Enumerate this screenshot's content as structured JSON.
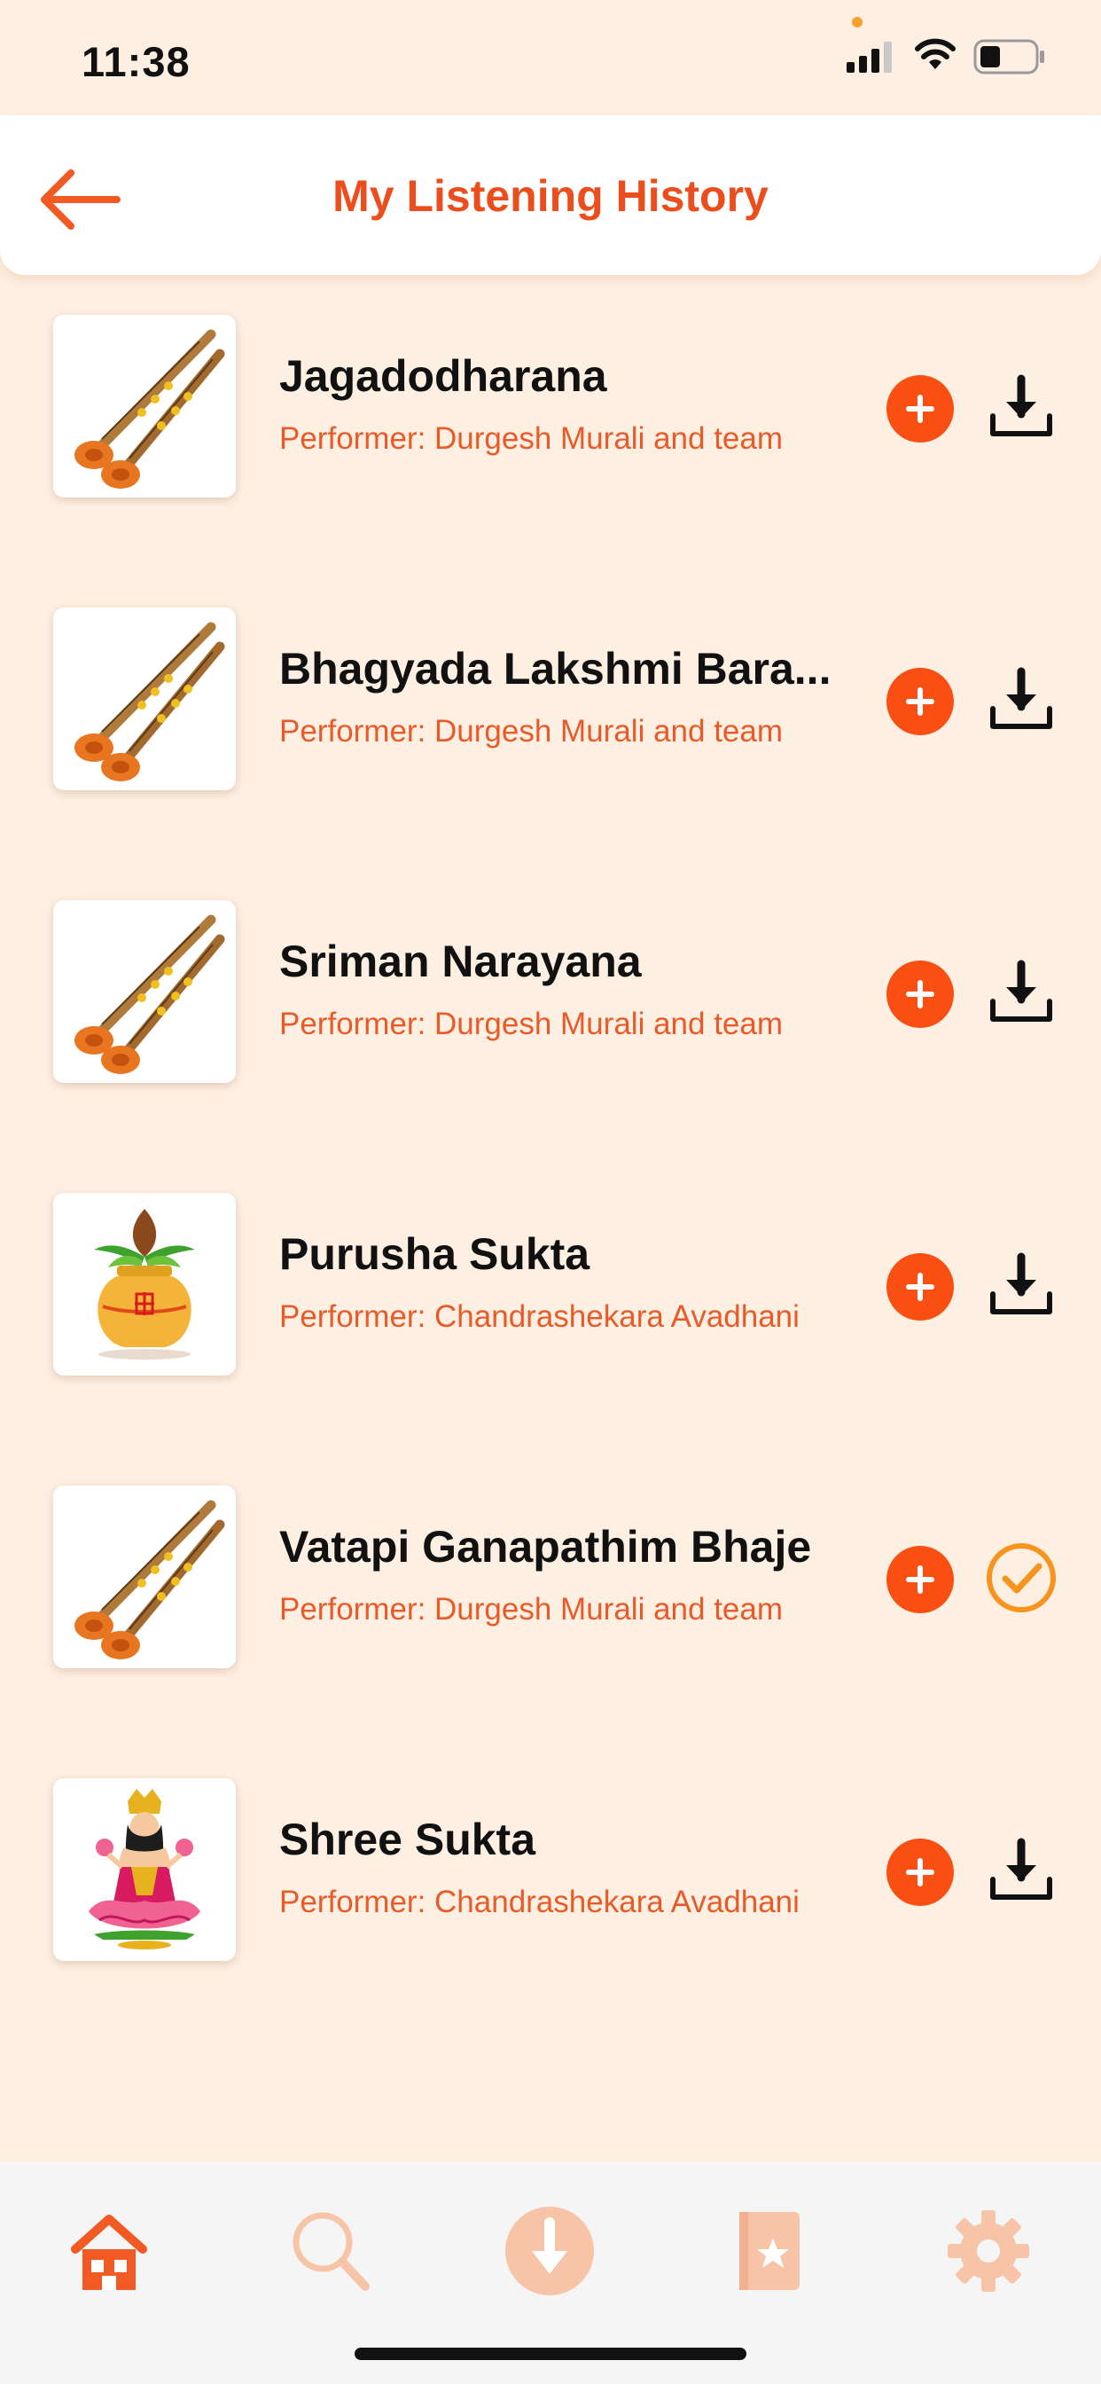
{
  "status_bar": {
    "time": "11:38"
  },
  "header": {
    "title": "My Listening History",
    "back_icon": "arrow-left-icon",
    "accent_color": "#ec4d1c"
  },
  "tracks": [
    {
      "title": "Jagadodharana",
      "performer": "Performer: Durgesh Murali and team",
      "thumbnail": "nadaswaram-icon",
      "downloaded": false
    },
    {
      "title": "Bhagyada Lakshmi Bara...",
      "performer": "Performer: Durgesh Murali and team",
      "thumbnail": "nadaswaram-icon",
      "downloaded": false
    },
    {
      "title": "Sriman Narayana",
      "performer": "Performer: Durgesh Murali and team",
      "thumbnail": "nadaswaram-icon",
      "downloaded": false
    },
    {
      "title": "Purusha Sukta",
      "performer": "Performer: Chandrashekara Avadhani",
      "thumbnail": "kalasha-icon",
      "downloaded": false
    },
    {
      "title": "Vatapi Ganapathim Bhaje",
      "performer": "Performer: Durgesh Murali and team",
      "thumbnail": "nadaswaram-icon",
      "downloaded": true
    },
    {
      "title": "Shree Sukta",
      "performer": "Performer: Chandrashekara Avadhani",
      "thumbnail": "lakshmi-icon",
      "downloaded": false
    }
  ],
  "tab_bar": {
    "items": [
      {
        "icon": "home-icon",
        "active": true
      },
      {
        "icon": "search-icon",
        "active": false
      },
      {
        "icon": "download-circle-icon",
        "active": false
      },
      {
        "icon": "bookmark-book-icon",
        "active": false
      },
      {
        "icon": "gear-icon",
        "active": false
      }
    ],
    "active_color": "#f15a22",
    "inactive_color": "#f7c4a8"
  }
}
